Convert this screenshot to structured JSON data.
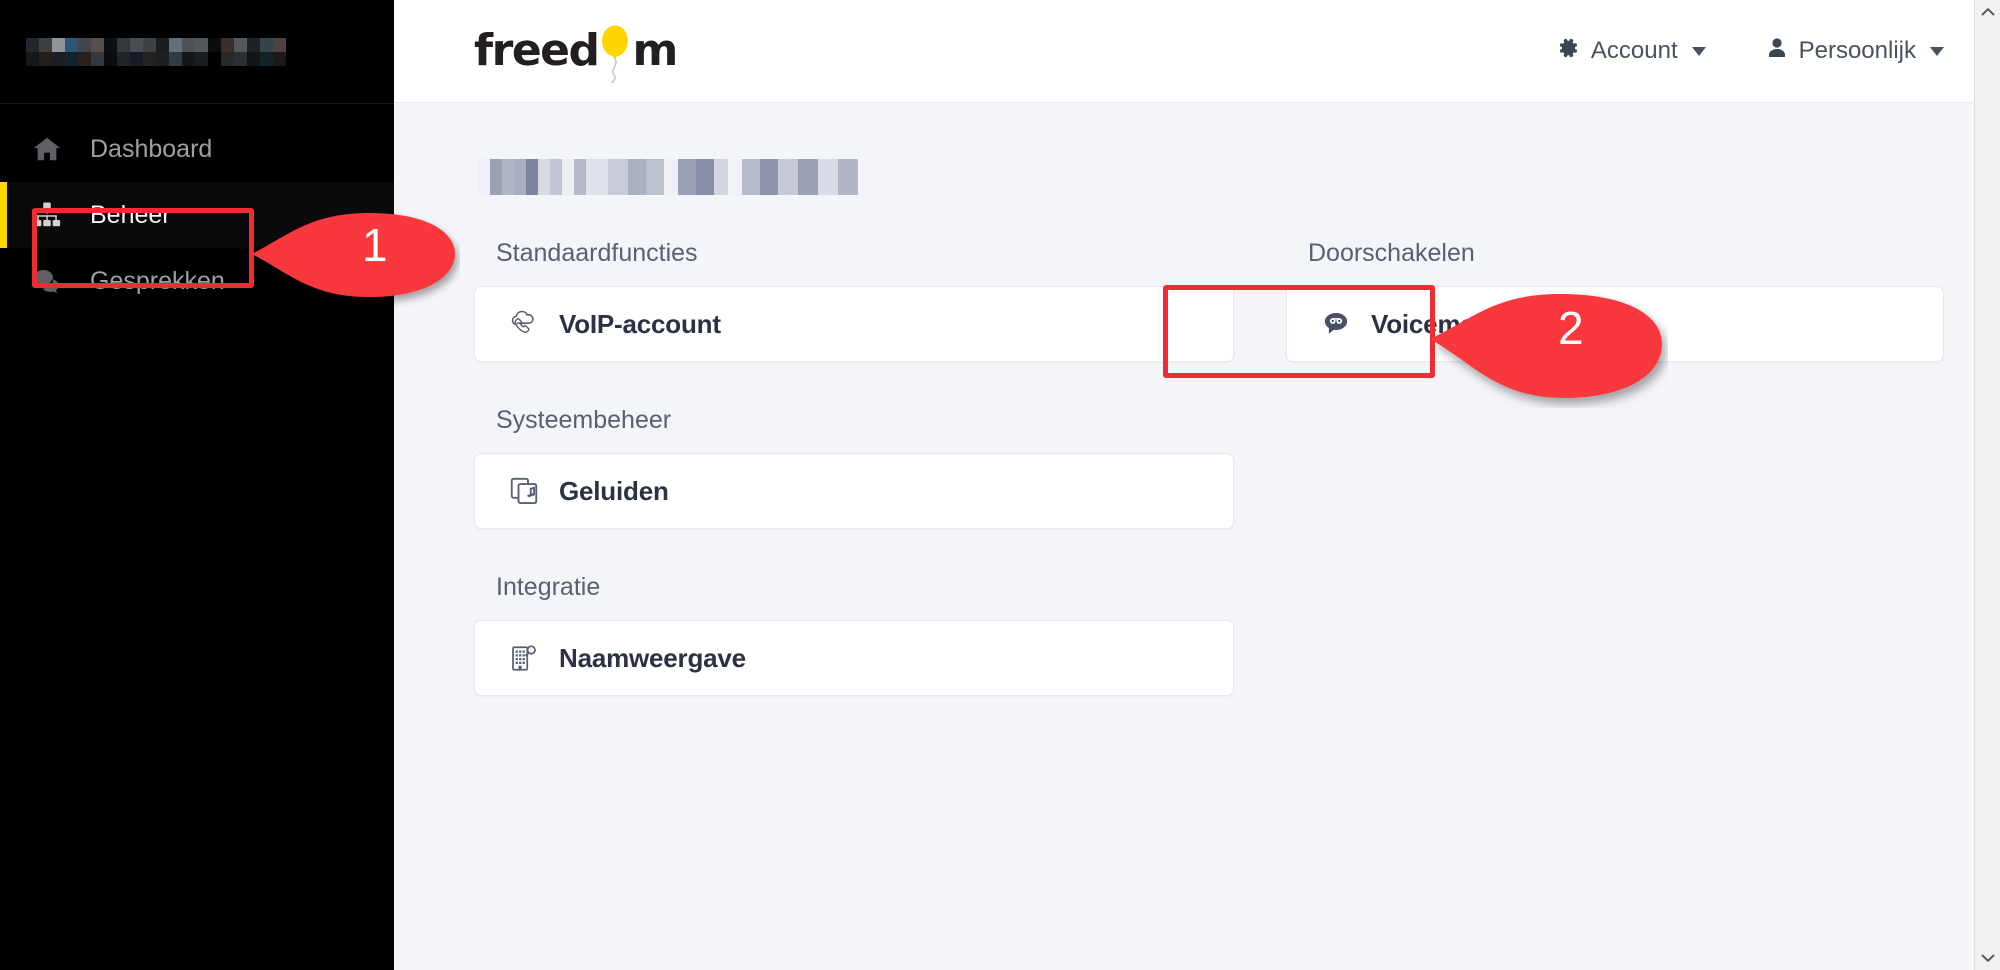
{
  "sidebar": {
    "account_name_redacted": true,
    "items": [
      {
        "label": "Dashboard",
        "icon": "home-icon",
        "active": false
      },
      {
        "label": "Beheer",
        "icon": "sitemap-icon",
        "active": true
      },
      {
        "label": "Gesprekken",
        "icon": "chat-bubbles-icon",
        "active": false
      }
    ]
  },
  "header": {
    "logo_text_before": "freed",
    "logo_text_after": "m",
    "logo_balloon_color": "#ffd500",
    "nav": [
      {
        "label": "Account",
        "icon": "gear-icon",
        "caret": true
      },
      {
        "label": "Persoonlijk",
        "icon": "person-icon",
        "caret": true
      }
    ]
  },
  "main": {
    "page_title_redacted": true,
    "sections": [
      {
        "title": "Standaardfuncties",
        "column": "left",
        "cards": [
          {
            "label": "VoIP-account",
            "icon": "cloud-phone-icon"
          }
        ]
      },
      {
        "title": "Doorschakelen",
        "column": "right",
        "cards": [
          {
            "label": "Voicemail",
            "icon": "voicemail-bubble-icon",
            "highlighted": true
          }
        ]
      },
      {
        "title": "Systeembeheer",
        "column": "left",
        "cards": [
          {
            "label": "Geluiden",
            "icon": "sound-files-icon"
          }
        ]
      },
      {
        "title": "Integratie",
        "column": "left",
        "cards": [
          {
            "label": "Naamweergave",
            "icon": "building-search-icon"
          }
        ]
      }
    ]
  },
  "annotations": [
    {
      "number": "1",
      "target": "sidebar-item-beheer",
      "color": "#ee2d33"
    },
    {
      "number": "2",
      "target": "voicemail-card",
      "color": "#ee2d33"
    }
  ],
  "colors": {
    "accent_yellow": "#ffd500",
    "annotation_red": "#ee2d33",
    "sidebar_bg": "#000000",
    "content_bg": "#f4f5f9",
    "card_bg": "#ffffff"
  },
  "scrollbar": {
    "up_arrow": "chevron-up-icon",
    "down_arrow": "chevron-down-icon"
  }
}
